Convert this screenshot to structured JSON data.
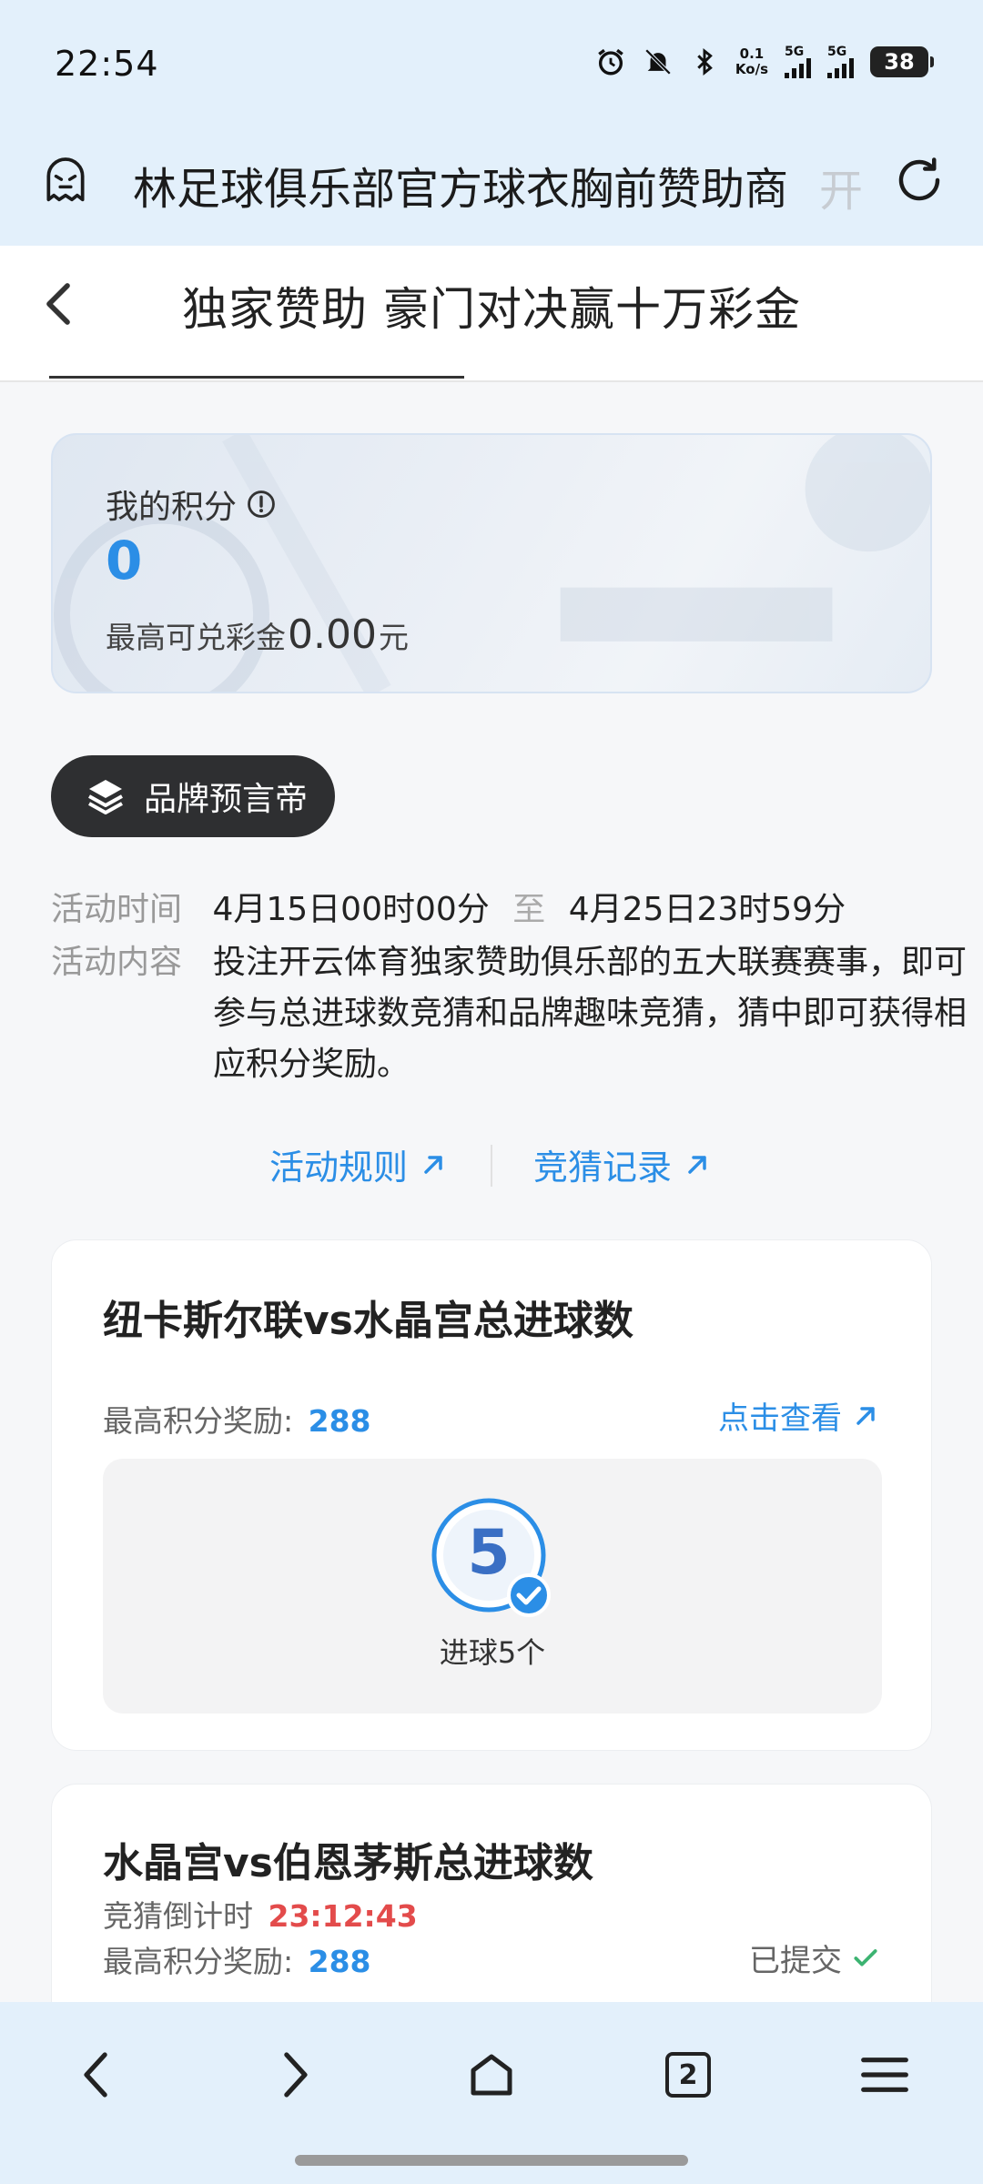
{
  "status_bar": {
    "time": "22:54",
    "speed_value": "0.1",
    "speed_unit": "Ko/s",
    "sim1": "5G",
    "sim2": "5G",
    "battery": "38"
  },
  "browser": {
    "url_text": "林足球俱乐部官方球衣胸前赞助商",
    "url_overflow": "开"
  },
  "header": {
    "title": "独家赞助 豪门对决赢十万彩金"
  },
  "points_card": {
    "label": "我的积分",
    "value": "0",
    "redeem_prefix": "最高可兑彩金",
    "redeem_amount": "0.00",
    "redeem_unit": "元"
  },
  "brand_tag": {
    "label": "品牌预言帝"
  },
  "activity": {
    "time_label": "活动时间",
    "start": "4月15日00时00分",
    "separator": "至",
    "end": "4月25日23时59分",
    "content_label": "活动内容",
    "content": "投注开云体育独家赞助俱乐部的五大联赛赛事，即可参与总进球数竞猜和品牌趣味竞猜，猜中即可获得相应积分奖励。"
  },
  "links": {
    "rules": "活动规则",
    "records": "竞猜记录"
  },
  "matches": [
    {
      "title": "纽卡斯尔联vs水晶宫总进球数",
      "reward_label": "最高积分奖励:",
      "reward_value": "288",
      "view_label": "点击查看",
      "goal_number": "5",
      "goal_caption": "进球5个"
    },
    {
      "title": "水晶宫vs伯恩茅斯总进球数",
      "countdown_label": "竞猜倒计时",
      "countdown_value": "23:12:43",
      "reward_label": "最高积分奖励:",
      "reward_value": "288",
      "status": "已提交"
    }
  ],
  "bottom_nav": {
    "tab_count": "2"
  },
  "colors": {
    "accent_blue": "#2b8ee6",
    "countdown_red": "#e34b4b",
    "check_green": "#3cb371",
    "brand_dark": "#2e2f31",
    "chrome_bg": "#e3f0fb"
  }
}
